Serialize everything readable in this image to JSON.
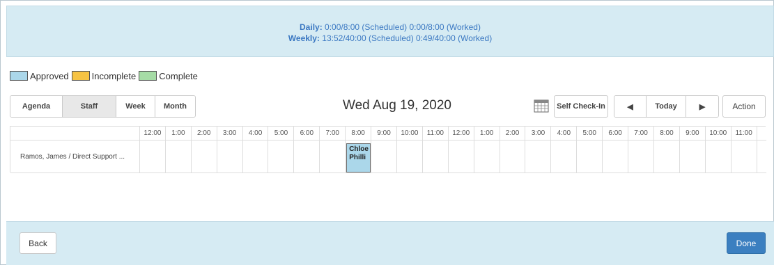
{
  "summary": {
    "daily_label": "Daily:",
    "daily_value": "0:00/8:00 (Scheduled) 0:00/8:00 (Worked)",
    "weekly_label": "Weekly:",
    "weekly_value": "13:52/40:00 (Scheduled) 0:49/40:00 (Worked)"
  },
  "legend": [
    {
      "label": "Approved",
      "color": "#abd7ea"
    },
    {
      "label": "Incomplete",
      "color": "#f6c343"
    },
    {
      "label": "Complete",
      "color": "#a6dca6"
    }
  ],
  "view_tabs": {
    "agenda": "Agenda",
    "staff": "Staff",
    "week": "Week",
    "month": "Month",
    "active": "Staff"
  },
  "date_title": "Wed Aug 19, 2020",
  "toolbar": {
    "self_checkin": "Self Check-In",
    "prev_icon": "◀",
    "today": "Today",
    "next_icon": "▶",
    "action": "Action"
  },
  "grid": {
    "hours": [
      "12:00",
      "1:00",
      "2:00",
      "3:00",
      "4:00",
      "5:00",
      "6:00",
      "7:00",
      "8:00",
      "9:00",
      "10:00",
      "11:00",
      "12:00",
      "1:00",
      "2:00",
      "3:00",
      "4:00",
      "5:00",
      "6:00",
      "7:00",
      "8:00",
      "9:00",
      "10:00",
      "11:00"
    ],
    "staff_row": "Ramos, James / Direct Support ...",
    "shift": {
      "line1": "Chloe",
      "line2": "Philli",
      "status": "Approved",
      "start_hour_index": 8
    }
  },
  "footer": {
    "back": "Back",
    "done": "Done"
  },
  "colors": {
    "banner_bg": "#d6ebf3",
    "banner_text": "#3b78c2",
    "primary_button": "#3b7fc0"
  }
}
